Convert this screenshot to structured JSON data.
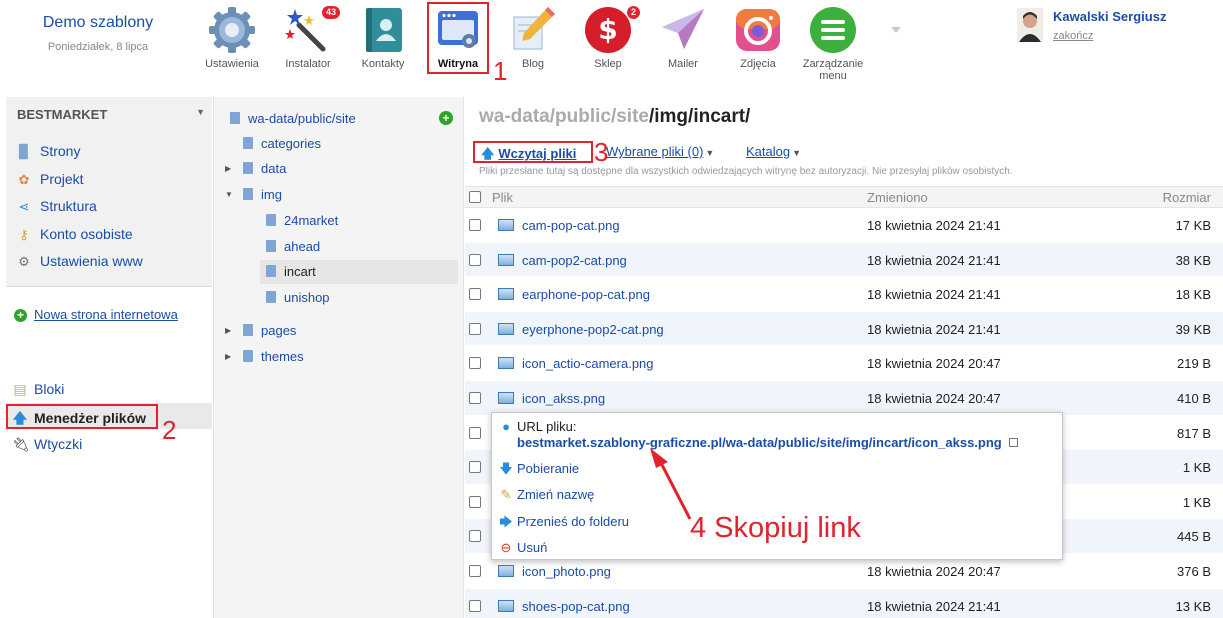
{
  "brand": {
    "name": "Demo szablony",
    "date": "Poniedziałek, 8 lipca"
  },
  "apps": [
    {
      "label": "Ustawienia",
      "icon": "gear-icon"
    },
    {
      "label": "Instalator",
      "icon": "magic-wand-icon",
      "badge": "43"
    },
    {
      "label": "Kontakty",
      "icon": "contacts-book-icon"
    },
    {
      "label": "Witryna",
      "icon": "website-icon"
    },
    {
      "label": "Blog",
      "icon": "pencil-icon"
    },
    {
      "label": "Sklep",
      "icon": "dollar-icon",
      "badge": "2"
    },
    {
      "label": "Mailer",
      "icon": "paper-plane-icon"
    },
    {
      "label": "Zdjęcia",
      "icon": "camera-icon"
    },
    {
      "label": "Zarządzanie menu",
      "icon": "menu-icon"
    }
  ],
  "user": {
    "name": "Kawalski Sergiusz",
    "logout": "zakończ"
  },
  "site": {
    "title": "BESTMARKET",
    "nav": [
      {
        "label": "Strony",
        "icon": "page-icon"
      },
      {
        "label": "Projekt",
        "icon": "palette-icon"
      },
      {
        "label": "Struktura",
        "icon": "share-icon"
      },
      {
        "label": "Konto osobiste",
        "icon": "key-icon"
      },
      {
        "label": "Ustawienia www",
        "icon": "gear-icon"
      }
    ],
    "new_site": "Nowa strona internetowa",
    "lower_nav": [
      {
        "label": "Bloki",
        "icon": "blocks-icon"
      },
      {
        "label": "Menedżer plików",
        "icon": "upload-arrow-icon"
      },
      {
        "label": "Wtyczki",
        "icon": "plug-icon"
      }
    ]
  },
  "tree": {
    "root": "wa-data/public/site",
    "nodes": [
      "categories",
      "data",
      "img",
      "24market",
      "ahead",
      "incart",
      "unishop",
      "pages",
      "themes"
    ]
  },
  "main": {
    "breadcrumb_dim": "wa-data/public/site",
    "breadcrumb_current": "/img/incart/",
    "upload_label": "Wczytaj pliki",
    "selected_label": "Wybrane pliki (0)",
    "catalog_label": "Katalog",
    "notice": "Pliki przesłane tutaj są dostępne dla wszystkich odwiedzających witrynę bez autoryzacji. Nie przesyłaj plików osobistych.",
    "columns": {
      "name": "Plik",
      "modified": "Zmieniono",
      "size": "Rozmiar"
    },
    "files": [
      {
        "name": "cam-pop-cat.png",
        "modified": "18 kwietnia 2024 21:41",
        "size": "17 KB"
      },
      {
        "name": "cam-pop2-cat.png",
        "modified": "18 kwietnia 2024 21:41",
        "size": "38 KB"
      },
      {
        "name": "earphone-pop-cat.png",
        "modified": "18 kwietnia 2024 21:41",
        "size": "18 KB"
      },
      {
        "name": "eyerphone-pop2-cat.png",
        "modified": "18 kwietnia 2024 21:41",
        "size": "39 KB"
      },
      {
        "name": "icon_actio-camera.png",
        "modified": "18 kwietnia 2024 20:47",
        "size": "219 B"
      },
      {
        "name": "icon_akss.png",
        "modified": "18 kwietnia 2024 20:47",
        "size": "410 B"
      },
      {
        "name": "",
        "modified": "",
        "size": "817 B"
      },
      {
        "name": "",
        "modified": "",
        "size": "1 KB"
      },
      {
        "name": "",
        "modified": "",
        "size": "1 KB"
      },
      {
        "name": "",
        "modified": "",
        "size": "445 B"
      },
      {
        "name": "icon_photo.png",
        "modified": "18 kwietnia 2024 20:47",
        "size": "376 B"
      },
      {
        "name": "shoes-pop-cat.png",
        "modified": "18 kwietnia 2024 21:41",
        "size": "13 KB"
      }
    ]
  },
  "popup": {
    "url_label": "URL pliku:",
    "url": "bestmarket.szablony-graficzne.pl/wa-data/public/site/img/incart/icon_akss.png",
    "download": "Pobieranie",
    "rename": "Zmień nazwę",
    "move": "Przenieś do folderu",
    "delete": "Usuń"
  },
  "annotations": {
    "a1": "1",
    "a2": "2",
    "a3": "3",
    "a4": "4 Skopiuj link"
  },
  "colors": {
    "accent": "#1a4ca8",
    "annotation": "#e0232d"
  }
}
